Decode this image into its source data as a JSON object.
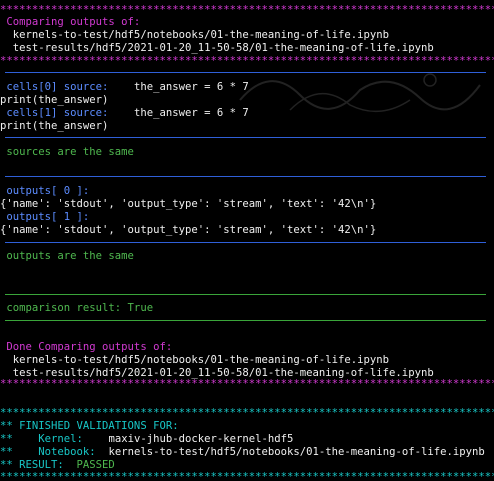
{
  "stars": "*************************************************************************************",
  "compare_header": {
    "title": " Comparing outputs of:",
    "file1": "  kernels-to-test/hdf5/notebooks/01-the-meaning-of-life.ipynb",
    "file2": "  test-results/hdf5/2021-01-20_11-50-58/01-the-meaning-of-life.ipynb"
  },
  "cells": [
    {
      "label": " cells[0] source:",
      "code": "    the_answer = 6 * 7",
      "line2": "print(the_answer)"
    },
    {
      "label": " cells[1] source:",
      "code": "    the_answer = 6 * 7",
      "line2": "print(the_answer)"
    }
  ],
  "sources_same": " sources are the same",
  "outputs": [
    {
      "label": " outputs[ 0 ]:",
      "value": "{'name': 'stdout', 'output_type': 'stream', 'text': '42\\n'}"
    },
    {
      "label": " outputs[ 1 ]:",
      "value": "{'name': 'stdout', 'output_type': 'stream', 'text': '42\\n'}"
    }
  ],
  "outputs_same": " outputs are the same",
  "comparison_result": " comparison result: True",
  "done_header": {
    "title": " Done Comparing outputs of:",
    "file1": "  kernels-to-test/hdf5/notebooks/01-the-meaning-of-life.ipynb",
    "file2": "  test-results/hdf5/2021-01-20_11-50-58/01-the-meaning-of-life.ipynb"
  },
  "finished": {
    "title": "** FINISHED VALIDATIONS FOR:",
    "kernel_prefix": "**    Kernel:    ",
    "kernel_value": "maxiv-jhub-docker-kernel-hdf5",
    "notebook_prefix": "**    Notebook:  ",
    "notebook_value": "kernels-to-test/hdf5/notebooks/01-the-meaning-of-life.ipynb",
    "result_prefix": "** RESULT:  ",
    "result_value": "PASSED"
  },
  "colors": {
    "magenta": "#d23ad2",
    "blue": "#5c8cff",
    "green": "#4fb84f",
    "cyan": "#18c7c7",
    "background": "#000000"
  }
}
